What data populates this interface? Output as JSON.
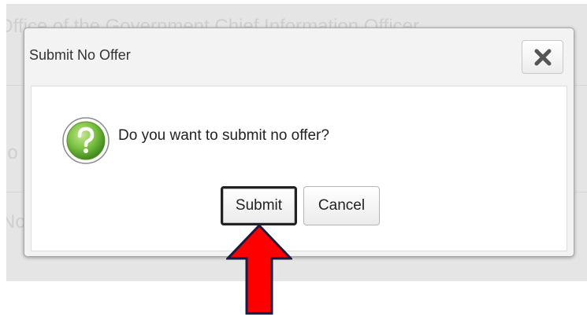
{
  "background": {
    "heading_fragment": "Office of the Government Chief Information Officer",
    "row2_fragment": "lo",
    "row3_fragment": "No"
  },
  "dialog": {
    "title": "Submit No Offer",
    "message": "Do you want to submit no offer?",
    "close_icon": "close-x-icon",
    "question_icon": "help-question-icon",
    "submit_label": "Submit",
    "cancel_label": "Cancel"
  },
  "annotation": {
    "arrow_icon": "red-up-arrow",
    "arrow_color": "#ff0000"
  },
  "colors": {
    "question_green": "#7cc243",
    "overlay": "#e5e5e5"
  }
}
